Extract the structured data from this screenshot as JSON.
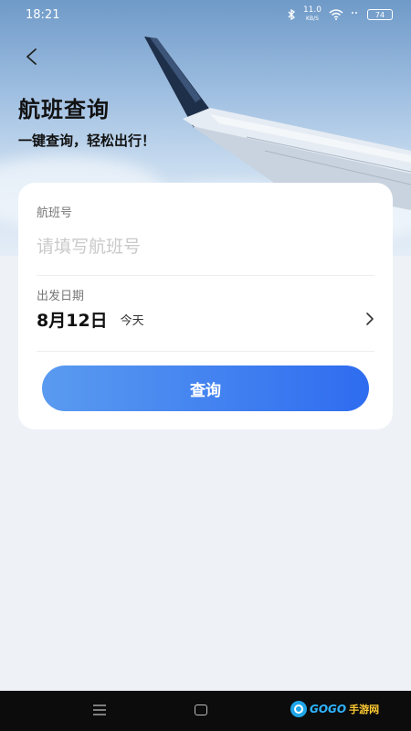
{
  "status_bar": {
    "time": "18:21",
    "speed_value": "11.0",
    "speed_unit": "KB/S",
    "battery": "74"
  },
  "header": {
    "title": "航班查询",
    "subtitle": "一键查询，轻松出行！"
  },
  "form": {
    "flight_label": "航班号",
    "flight_placeholder": "请填写航班号",
    "flight_value": "",
    "date_label": "出发日期",
    "date_value": "8月12日",
    "date_hint": "今天",
    "submit_label": "查询"
  },
  "watermark": {
    "brand": "GOGO",
    "brand_cn": "手游网"
  },
  "colors": {
    "accent_start": "#5a9bf0",
    "accent_end": "#2e6cf0",
    "page_bg": "#eef1f6"
  }
}
